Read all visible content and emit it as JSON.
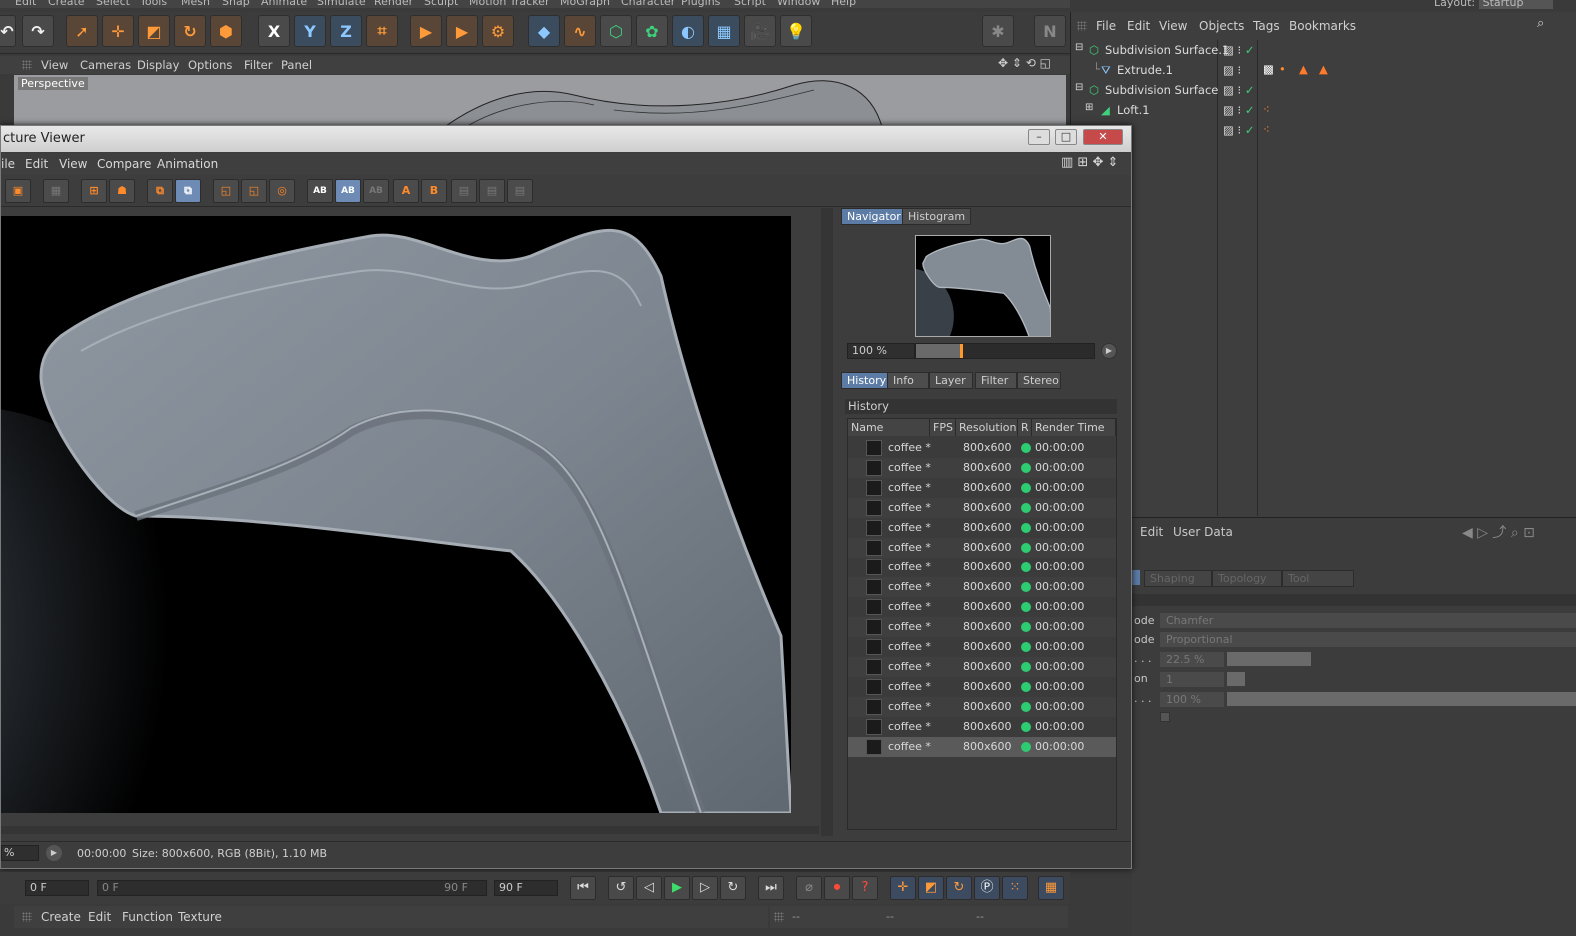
{
  "main_menu": [
    "Edit",
    "Create",
    "Select",
    "Tools",
    "Mesh",
    "Snap",
    "Animate",
    "Simulate",
    "Render",
    "Sculpt",
    "Motion Tracker",
    "MoGraph",
    "Character",
    "Plugins",
    "Script",
    "Window",
    "Help"
  ],
  "layout": {
    "label": "Layout:",
    "value": "Startup"
  },
  "toolbar": {
    "x_label": "X",
    "y_label": "Y",
    "z_label": "Z"
  },
  "viewport": {
    "menu": [
      "View",
      "Cameras",
      "Display",
      "Options",
      "Filter",
      "Panel"
    ],
    "label": "Perspective"
  },
  "object_manager": {
    "menu": [
      "File",
      "Edit",
      "View",
      "Objects",
      "Tags",
      "Bookmarks"
    ],
    "objects": [
      {
        "name": "Subdivision Surface.1"
      },
      {
        "name": "Extrude.1"
      },
      {
        "name": "Subdivision Surface"
      },
      {
        "name": "Loft.1"
      },
      {
        "name": ""
      }
    ]
  },
  "attribute_manager": {
    "menu": [
      "Edit",
      "User Data"
    ],
    "tabs": [
      "Shaping",
      "Topology",
      "Tool"
    ],
    "fields": [
      {
        "label": "ode",
        "value": "Chamfer"
      },
      {
        "label": "ode",
        "value": "Proportional"
      },
      {
        "label": ". . .",
        "value": "22.5 %"
      },
      {
        "label": "on",
        "value": "1"
      },
      {
        "label": ". . .",
        "value": "100 %"
      }
    ]
  },
  "picture_viewer": {
    "title": "cture Viewer",
    "menu": [
      "ile",
      "Edit",
      "View",
      "Compare",
      "Animation"
    ],
    "sidebar_tabs": [
      "Navigator",
      "Histogram"
    ],
    "zoom": "100 %",
    "info_tabs": [
      "History",
      "Info",
      "Layer",
      "Filter",
      "Stereo"
    ],
    "history_title": "History",
    "columns": [
      "Name",
      "FPS",
      "Resolution",
      "R",
      "Render Time"
    ],
    "history": [
      {
        "name": "coffee *",
        "resolution": "800x600",
        "time": "00:00:00"
      },
      {
        "name": "coffee *",
        "resolution": "800x600",
        "time": "00:00:00"
      },
      {
        "name": "coffee *",
        "resolution": "800x600",
        "time": "00:00:00"
      },
      {
        "name": "coffee *",
        "resolution": "800x600",
        "time": "00:00:00"
      },
      {
        "name": "coffee *",
        "resolution": "800x600",
        "time": "00:00:00"
      },
      {
        "name": "coffee *",
        "resolution": "800x600",
        "time": "00:00:00"
      },
      {
        "name": "coffee *",
        "resolution": "800x600",
        "time": "00:00:00"
      },
      {
        "name": "coffee *",
        "resolution": "800x600",
        "time": "00:00:00"
      },
      {
        "name": "coffee *",
        "resolution": "800x600",
        "time": "00:00:00"
      },
      {
        "name": "coffee *",
        "resolution": "800x600",
        "time": "00:00:00"
      },
      {
        "name": "coffee *",
        "resolution": "800x600",
        "time": "00:00:00"
      },
      {
        "name": "coffee *",
        "resolution": "800x600",
        "time": "00:00:00"
      },
      {
        "name": "coffee *",
        "resolution": "800x600",
        "time": "00:00:00"
      },
      {
        "name": "coffee *",
        "resolution": "800x600",
        "time": "00:00:00"
      },
      {
        "name": "coffee *",
        "resolution": "800x600",
        "time": "00:00:00"
      },
      {
        "name": "coffee *",
        "resolution": "800x600",
        "time": "00:00:00"
      }
    ],
    "status_zoom": "%",
    "status_time": "00:00:00",
    "status_info": "Size: 800x600, RGB (8Bit), 1.10 MB"
  },
  "timeline": {
    "start": "0 F",
    "range_start": "0 F",
    "range_end": "90 F",
    "end": "90 F"
  },
  "material_menu": [
    "Create",
    "Edit",
    "Function",
    "Texture"
  ],
  "coord_placeholder": [
    "--",
    "--",
    "--"
  ],
  "colors": {
    "accent_blue": "#5c7ca5",
    "render_ok": "#2ecc71",
    "orange": "#ff9a3a"
  }
}
